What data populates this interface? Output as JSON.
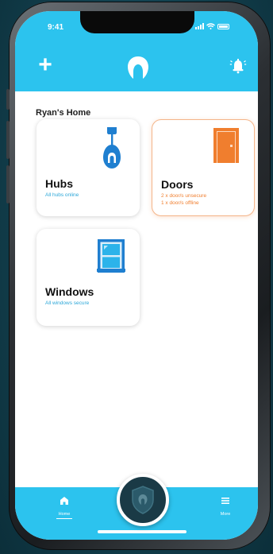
{
  "status_bar": {
    "time": "9:41"
  },
  "header": {
    "add_icon": "plus-icon",
    "logo_icon": "brand-logo-icon",
    "alarm_icon": "alarm-bell-icon",
    "add_label": "+"
  },
  "home": {
    "title": "Ryan's Home"
  },
  "cards": {
    "hubs": {
      "title": "Hubs",
      "status": "All hubs online",
      "icon": "hub-icon"
    },
    "doors": {
      "title": "Doors",
      "status_1": "2 x door/s unsecure",
      "status_2": "1 x door/s offline",
      "icon": "door-icon"
    },
    "windows": {
      "title": "Windows",
      "status": "All windows secure",
      "icon": "window-icon"
    }
  },
  "tabbar": {
    "home_label": "Home",
    "more_label": "More",
    "center_icon": "shield-icon"
  },
  "colors": {
    "accent": "#2cc3ee",
    "warning": "#f07e2e",
    "status_text": "#2ca7d8"
  }
}
